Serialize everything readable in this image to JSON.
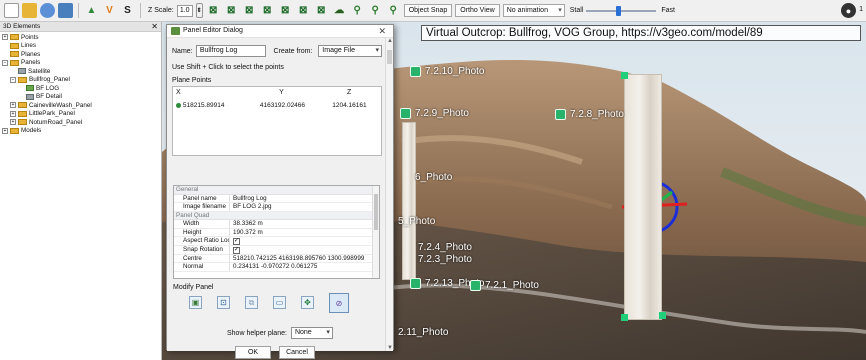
{
  "toolbar": {
    "icons": [
      "new-file-icon",
      "open-folder-icon",
      "globe-icon",
      "layers-icon",
      "mountain-icon",
      "vg-icon",
      "s-icon"
    ],
    "zscale_label": "Z Scale:",
    "zscale_value": "1.0",
    "object_snap_label": "Object Snap",
    "ortho_view_label": "Ortho View",
    "animation_value": "No animation",
    "stall_label": "Stall",
    "fast_label": "Fast",
    "speed_fraction": 0.45,
    "user_count": "1"
  },
  "side_panel": {
    "title": "3D Elements",
    "close": "✕",
    "items": [
      {
        "label": "Points",
        "depth": 0,
        "expander": "+",
        "icon": "folder"
      },
      {
        "label": "Lines",
        "depth": 0,
        "expander": "",
        "icon": "folder"
      },
      {
        "label": "Planes",
        "depth": 0,
        "expander": "",
        "icon": "folder"
      },
      {
        "label": "Panels",
        "depth": 0,
        "expander": "−",
        "icon": "folder"
      },
      {
        "label": "Satellite",
        "depth": 1,
        "expander": "",
        "icon": "grey"
      },
      {
        "label": "Bullfrog_Panel",
        "depth": 1,
        "expander": "−",
        "icon": "folder"
      },
      {
        "label": "BF LOG",
        "depth": 2,
        "expander": "",
        "icon": "green"
      },
      {
        "label": "BF Detail",
        "depth": 2,
        "expander": "",
        "icon": "grey"
      },
      {
        "label": "CainevilleWash_Panel",
        "depth": 1,
        "expander": "+",
        "icon": "folder"
      },
      {
        "label": "LittlePark_Panel",
        "depth": 1,
        "expander": "+",
        "icon": "folder"
      },
      {
        "label": "NotumRoad_Panel",
        "depth": 1,
        "expander": "+",
        "icon": "folder"
      },
      {
        "label": "Models",
        "depth": 0,
        "expander": "+",
        "icon": "folder"
      }
    ]
  },
  "dialog": {
    "title": "Panel Editor Dialog",
    "close": "✕",
    "name_label": "Name:",
    "name_value": "Bullfrog Log",
    "create_from_label": "Create from:",
    "create_from_value": "Image File",
    "hint": "Use Shift + Click to select the points",
    "plane_points_title": "Plane Points",
    "columns": [
      "X",
      "Y",
      "Z"
    ],
    "point": {
      "x": "518215.89914",
      "y": "4163192.02466",
      "z": "1204.16161"
    },
    "properties": [
      {
        "type": "cat",
        "label": "General"
      },
      {
        "type": "row",
        "key": "Panel name",
        "value": "Bullfrog Log"
      },
      {
        "type": "row",
        "key": "Image filename",
        "value": "BF LOG 2.jpg"
      },
      {
        "type": "cat",
        "label": "Panel Quad"
      },
      {
        "type": "row",
        "key": "Width",
        "value": "38.3362 m"
      },
      {
        "type": "row",
        "key": "Height",
        "value": "190.372 m"
      },
      {
        "type": "check",
        "key": "Aspect Ratio Lock"
      },
      {
        "type": "check",
        "key": "Snap Rotation"
      },
      {
        "type": "row",
        "key": "Centre",
        "value": "518210.742125    4163198.895760    1300.998999"
      },
      {
        "type": "row",
        "key": "Normal",
        "value": "0.234131   -0.970272   0.061275"
      }
    ],
    "modify_title": "Modify Panel",
    "modify_icons": [
      "image-icon",
      "crop-icon",
      "frame-icon",
      "resize-icon",
      "move-icon",
      "rotate-icon"
    ],
    "helper_label": "Show helper plane:",
    "helper_value": "None",
    "ok_label": "OK",
    "cancel_label": "Cancel"
  },
  "viewport": {
    "watermark": "Virtual Outcrop: Bullfrog, VOG Group, https://v3geo.com/model/89",
    "photos": [
      "7.2.10_Photo",
      "7.2.9_Photo",
      "7.2.8_Photo",
      "6_Photo",
      "5_Photo",
      "7.2.4_Photo",
      "7.2.3_Photo",
      "7.2.13_Photo",
      "7.2.1_Photo",
      "2.11_Photo"
    ]
  }
}
